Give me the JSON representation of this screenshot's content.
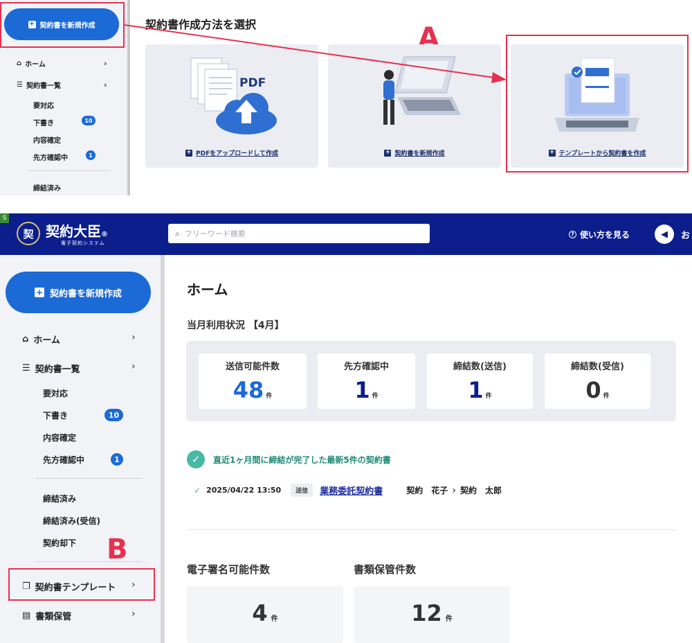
{
  "top_panel": {
    "new_contract_button": "契約書を新規作成",
    "nav_home": "ホーム",
    "nav_contract_list": "契約書一覧",
    "sub_items": [
      {
        "label": "要対応"
      },
      {
        "label": "下書き",
        "badge": "10"
      },
      {
        "label": "内容確定"
      },
      {
        "label": "先方確認中",
        "badge": "1"
      },
      {
        "label": "締結済み"
      }
    ],
    "method_title": "契約書作成方法を選択",
    "cards": [
      {
        "link": "PDFをアップロードして作成",
        "icon_label": "PDF"
      },
      {
        "link": "契約書を新規作成"
      },
      {
        "link": "テンプレートから契約書を作成"
      }
    ],
    "annotation_a": "A"
  },
  "header": {
    "logo_mark": "契",
    "logo_name": "契約大臣",
    "logo_registered": "®",
    "logo_sub": "電子契約システム",
    "search_placeholder": "フリーワード検索",
    "help_label": "使い方を見る",
    "cut_text": "お",
    "corner_tag": "S"
  },
  "sidebar": {
    "new_contract_button": "契約書を新規作成",
    "nav_home": "ホーム",
    "nav_contract_list": "契約書一覧",
    "sub_items": [
      {
        "label": "要対応"
      },
      {
        "label": "下書き",
        "badge": "10"
      },
      {
        "label": "内容確定"
      },
      {
        "label": "先方確認中",
        "badge": "1"
      }
    ],
    "done_items": [
      {
        "label": "締結済み"
      },
      {
        "label": "締結済み(受信)"
      },
      {
        "label": "契約却下"
      }
    ],
    "nav_templates": "契約書テンプレート",
    "nav_storage": "書類保管",
    "annotation_b": "B"
  },
  "main": {
    "title": "ホーム",
    "usage_title": "当月利用状況 【4月】",
    "usage_cards": [
      {
        "label": "送信可能件数",
        "value": "48",
        "unit": "件",
        "color": "#1c6ad6"
      },
      {
        "label": "先方確認中",
        "value": "1",
        "unit": "件",
        "color": "#0b1e8c"
      },
      {
        "label": "締結数(送信)",
        "value": "1",
        "unit": "件",
        "color": "#0b1e8c"
      },
      {
        "label": "締結数(受信)",
        "value": "0",
        "unit": "件",
        "color": "#333333"
      }
    ],
    "recent_heading": "直近1ヶ月間に締結が完了した最新5件の契約書",
    "recent_row": {
      "datetime": "2025/04/22 13:50",
      "tag": "送信",
      "doc_name": "業務委託契約書",
      "from": "契約　花子",
      "separator": "›",
      "to": "契約　太郎"
    },
    "stats": [
      {
        "label": "電子署名可能件数",
        "value": "4",
        "unit": "件"
      },
      {
        "label": "書類保管件数",
        "value": "12",
        "unit": "件"
      }
    ]
  },
  "colors": {
    "brand_navy": "#0b1e8c",
    "accent_blue": "#1c6ad6",
    "annotation_red": "#e8304f",
    "success_teal": "#48b9a4"
  }
}
